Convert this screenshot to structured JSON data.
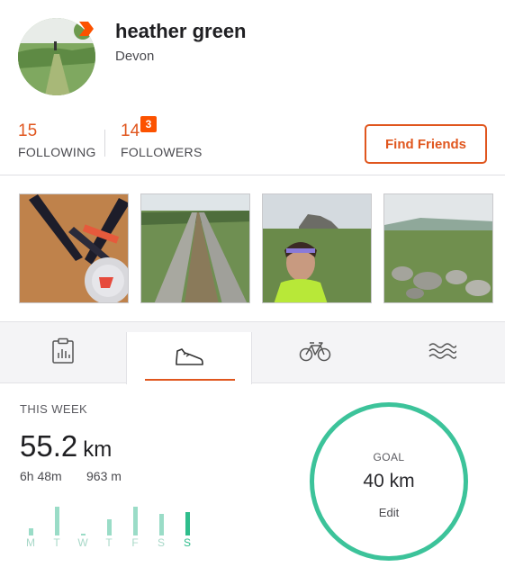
{
  "profile": {
    "name": "heather green",
    "location": "Devon",
    "avatar_icon": "profile-photo",
    "badge_icon": "subscriber-chevron-icon",
    "brand_color": "#fc5200"
  },
  "stats": {
    "following_count": "15",
    "following_label": "FOLLOWING",
    "followers_count": "14",
    "followers_label": "FOLLOWERS",
    "followers_badge": "3",
    "find_friends_label": "Find Friends"
  },
  "photos": [
    {
      "icon": "medal-photo"
    },
    {
      "icon": "moorland-track-photo"
    },
    {
      "icon": "selfie-tor-photo"
    },
    {
      "icon": "moorland-rocks-photo"
    }
  ],
  "tabs": [
    {
      "icon": "clipboard-stats-icon",
      "active": false
    },
    {
      "icon": "running-shoe-icon",
      "active": true
    },
    {
      "icon": "bicycle-icon",
      "active": false
    },
    {
      "icon": "swim-waves-icon",
      "active": false
    }
  ],
  "week": {
    "title": "THIS WEEK",
    "distance": "55.2",
    "unit": "km",
    "time": "6h 48m",
    "elevation": "963 m",
    "days": [
      {
        "label": "M",
        "level": 0.25,
        "today": false
      },
      {
        "label": "T",
        "level": 1.0,
        "today": false
      },
      {
        "label": "W",
        "level": 0.05,
        "today": false
      },
      {
        "label": "T",
        "level": 0.55,
        "today": false
      },
      {
        "label": "F",
        "level": 1.0,
        "today": false
      },
      {
        "label": "S",
        "level": 0.75,
        "today": false
      },
      {
        "label": "S",
        "level": 0.8,
        "today": true
      }
    ]
  },
  "goal": {
    "title": "GOAL",
    "value": "40 km",
    "edit_label": "Edit",
    "ring_color": "#3cc39a"
  }
}
